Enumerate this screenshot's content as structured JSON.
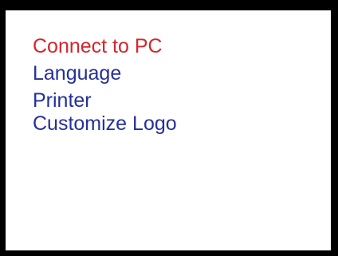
{
  "menu": {
    "items": [
      {
        "label": "Connect to PC",
        "selected": true
      },
      {
        "label": "Language",
        "selected": false
      },
      {
        "label": "Printer",
        "selected": false
      },
      {
        "label": "Customize Logo",
        "selected": false
      }
    ]
  },
  "colors": {
    "selected_text": "#d5262c",
    "normal_text": "#25309a",
    "background": "#ffffff",
    "frame": "#000000"
  }
}
